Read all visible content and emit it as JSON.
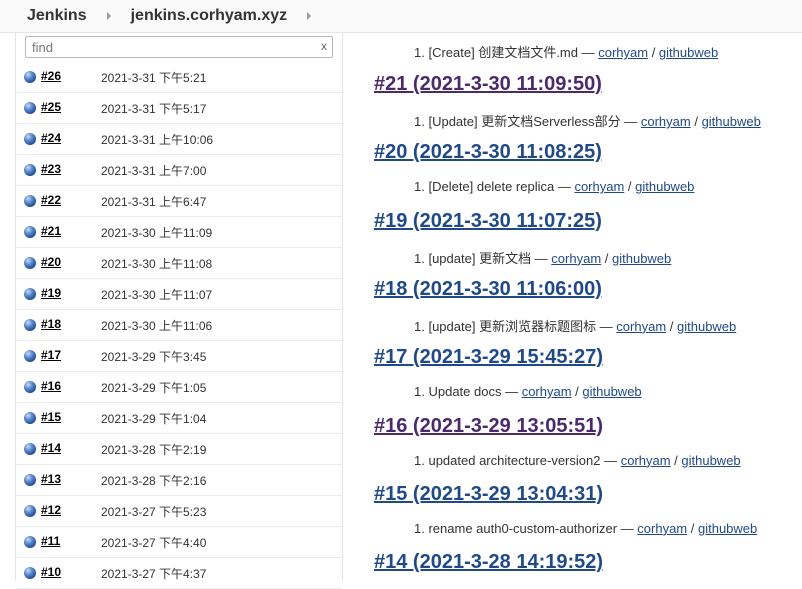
{
  "breadcrumb": {
    "items": [
      "Jenkins",
      "jenkins.corhyam.xyz"
    ]
  },
  "build_history": {
    "filter_placeholder": "find",
    "filter_clear": "x",
    "builds": [
      {
        "number": "#26",
        "date": "2021-3-31 下午5:21"
      },
      {
        "number": "#25",
        "date": "2021-3-31 下午5:17"
      },
      {
        "number": "#24",
        "date": "2021-3-31 上午10:06"
      },
      {
        "number": "#23",
        "date": "2021-3-31 上午7:00"
      },
      {
        "number": "#22",
        "date": "2021-3-31 上午6:47"
      },
      {
        "number": "#21",
        "date": "2021-3-30 上午11:09"
      },
      {
        "number": "#20",
        "date": "2021-3-30 上午11:08"
      },
      {
        "number": "#19",
        "date": "2021-3-30 上午11:07"
      },
      {
        "number": "#18",
        "date": "2021-3-30 上午11:06"
      },
      {
        "number": "#17",
        "date": "2021-3-29 下午3:45"
      },
      {
        "number": "#16",
        "date": "2021-3-29 下午1:05"
      },
      {
        "number": "#15",
        "date": "2021-3-29 下午1:04"
      },
      {
        "number": "#14",
        "date": "2021-3-28 下午2:19"
      },
      {
        "number": "#13",
        "date": "2021-3-28 下午2:16"
      },
      {
        "number": "#12",
        "date": "2021-3-27 下午5:23"
      },
      {
        "number": "#11",
        "date": "2021-3-27 下午4:40"
      },
      {
        "number": "#10",
        "date": "2021-3-27 下午4:37"
      }
    ]
  },
  "changes": {
    "top_item": {
      "n": "1.",
      "text": "[Create] 创建文档文件.md — ",
      "author": "corhyam",
      "sep": " / ",
      "repo": "githubweb"
    },
    "entries": [
      {
        "heading": "#21 (2021-3-30 11:09:50)",
        "n": "1.",
        "text": "[Update] 更新文档Serverless部分 — ",
        "author": "corhyam",
        "sep": " / ",
        "repo": "githubweb"
      },
      {
        "heading": "#20 (2021-3-30 11:08:25)",
        "n": "1.",
        "text": "[Delete] delete replica — ",
        "author": "corhyam",
        "sep": " / ",
        "repo": "githubweb"
      },
      {
        "heading": "#19 (2021-3-30 11:07:25)",
        "n": "1.",
        "text": "[update] 更新文档 — ",
        "author": "corhyam",
        "sep": " / ",
        "repo": "githubweb"
      },
      {
        "heading": "#18 (2021-3-30 11:06:00)",
        "n": "1.",
        "text": "[update] 更新浏览器标题图标 — ",
        "author": "corhyam",
        "sep": " / ",
        "repo": "githubweb"
      },
      {
        "heading": "#17 (2021-3-29 15:45:27)",
        "n": "1.",
        "text": "Update docs — ",
        "author": "corhyam",
        "sep": " / ",
        "repo": "githubweb"
      },
      {
        "heading": "#16 (2021-3-29 13:05:51)",
        "n": "1.",
        "text": "updated architecture-version2 — ",
        "author": "corhyam",
        "sep": " / ",
        "repo": "githubweb"
      },
      {
        "heading": "#15 (2021-3-29 13:04:31)",
        "n": "1.",
        "text": "rename auth0-custom-authorizer — ",
        "author": "corhyam",
        "sep": " / ",
        "repo": "githubweb"
      },
      {
        "heading": "#14 (2021-3-28 14:19:52)"
      }
    ]
  },
  "icons": {
    "build_status": "blue-ball-icon",
    "breadcrumb_separator": "chevron-right-icon"
  },
  "colors": {
    "link": "#204a87",
    "visited_link": "#4b2a6b",
    "status_blue": "#3b6bb5"
  }
}
